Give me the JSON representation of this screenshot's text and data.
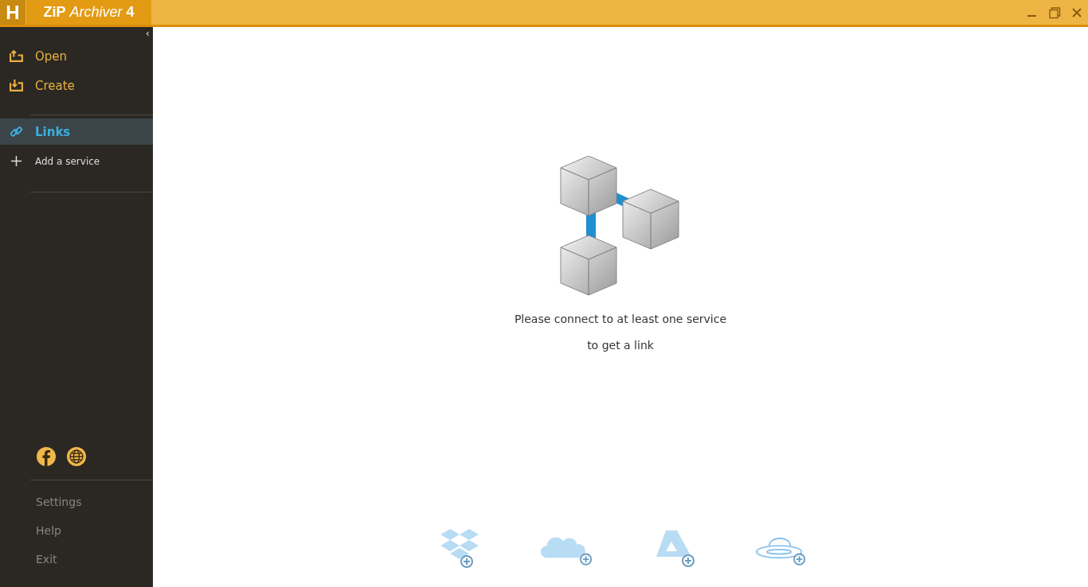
{
  "window": {
    "logo": "H",
    "title": "**ZiP** *Archiver* **4**"
  },
  "sidebar": {
    "collapse": "‹",
    "top_items": [
      {
        "label": "Open",
        "kind": "open",
        "selected": false
      },
      {
        "label": "Create",
        "kind": "create",
        "selected": false
      }
    ],
    "link_items": [
      {
        "label": "Links",
        "kind": "links",
        "selected": true
      },
      {
        "label": "Add a service",
        "kind": "add",
        "selected": false
      }
    ],
    "social": [
      {
        "kind": "facebook"
      },
      {
        "kind": "web"
      }
    ],
    "bottom_items": [
      "Settings",
      "Help",
      "Exit"
    ]
  },
  "main": {
    "message_lines": [
      "Please connect to at least one service",
      "to get a link"
    ],
    "services": [
      {
        "kind": "dropbox"
      },
      {
        "kind": "onedrive"
      },
      {
        "kind": "drive"
      },
      {
        "kind": "yandex"
      }
    ]
  }
}
